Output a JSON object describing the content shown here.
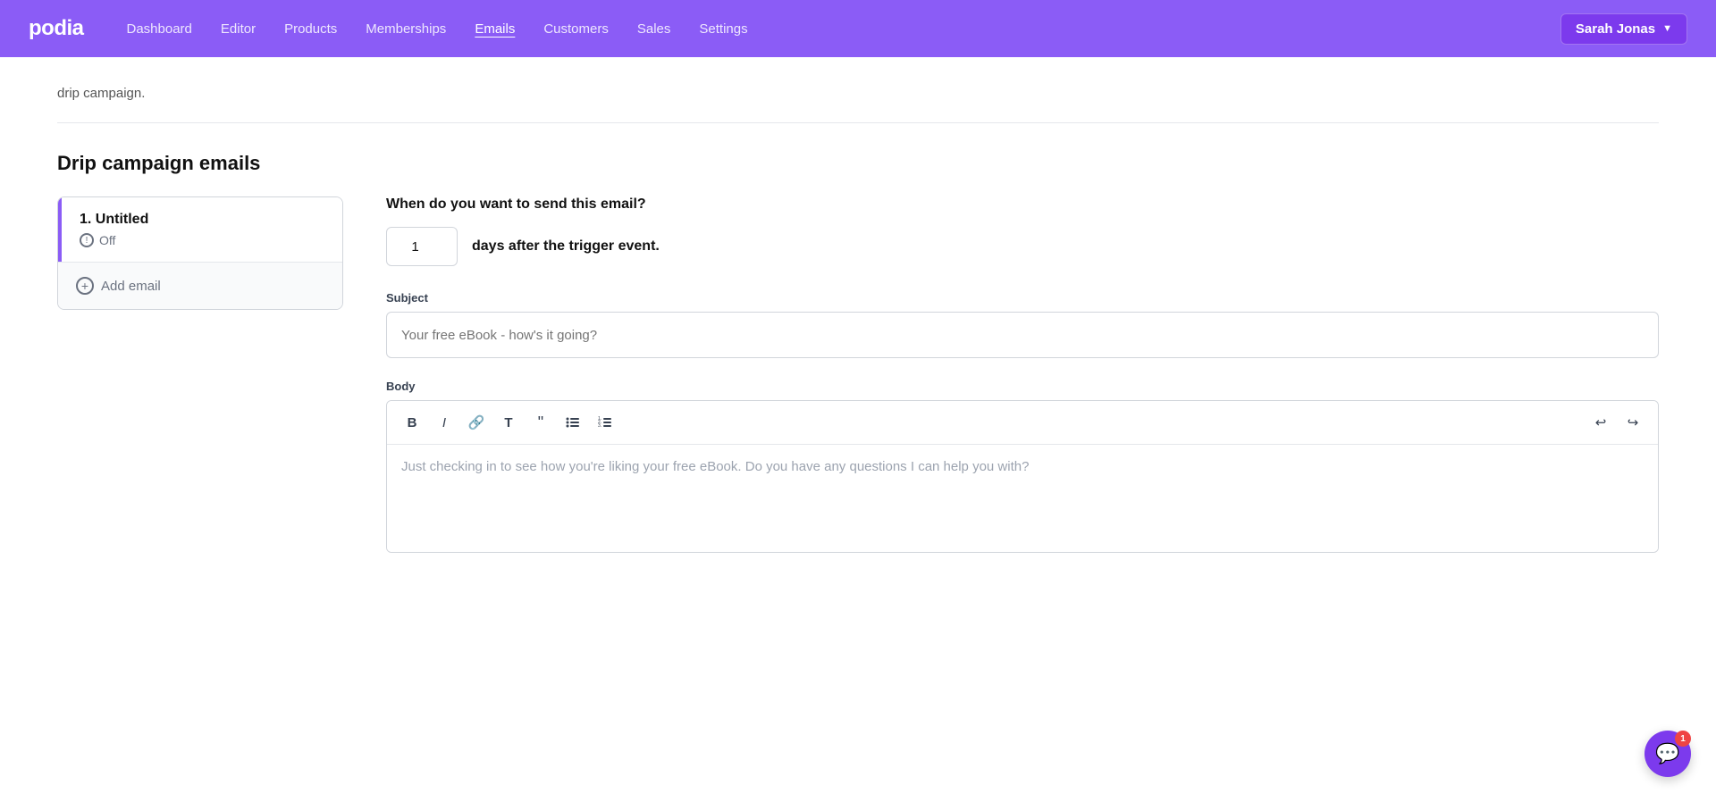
{
  "navbar": {
    "logo": "podia",
    "links": [
      {
        "label": "Dashboard",
        "active": false
      },
      {
        "label": "Editor",
        "active": false
      },
      {
        "label": "Products",
        "active": false
      },
      {
        "label": "Memberships",
        "active": false
      },
      {
        "label": "Emails",
        "active": true
      },
      {
        "label": "Customers",
        "active": false
      },
      {
        "label": "Sales",
        "active": false
      },
      {
        "label": "Settings",
        "active": false
      }
    ],
    "user_label": "Sarah Jonas",
    "chevron": "▼"
  },
  "page": {
    "drip_intro": "drip campaign.",
    "section_title": "Drip campaign emails",
    "email_list": [
      {
        "title": "1. Untitled",
        "status": "Off"
      }
    ],
    "add_email_label": "Add email",
    "when_send_question": "When do you want to send this email?",
    "days_value": "1",
    "days_after_label": "days after the trigger event.",
    "subject_label": "Subject",
    "subject_placeholder": "Your free eBook - how's it going?",
    "body_label": "Body",
    "body_placeholder": "Just checking in to see how you're liking your free eBook. Do you have any questions I can help you with?",
    "toolbar_buttons": [
      {
        "label": "B",
        "name": "bold-button"
      },
      {
        "label": "I",
        "name": "italic-button"
      },
      {
        "label": "🔗",
        "name": "link-button"
      },
      {
        "label": "T",
        "name": "text-button"
      },
      {
        "label": "❝",
        "name": "quote-button"
      },
      {
        "label": "≡",
        "name": "ul-button"
      },
      {
        "label": "☰",
        "name": "ol-button"
      }
    ],
    "undo_label": "↩",
    "redo_label": "↪",
    "chat_badge": "1"
  }
}
